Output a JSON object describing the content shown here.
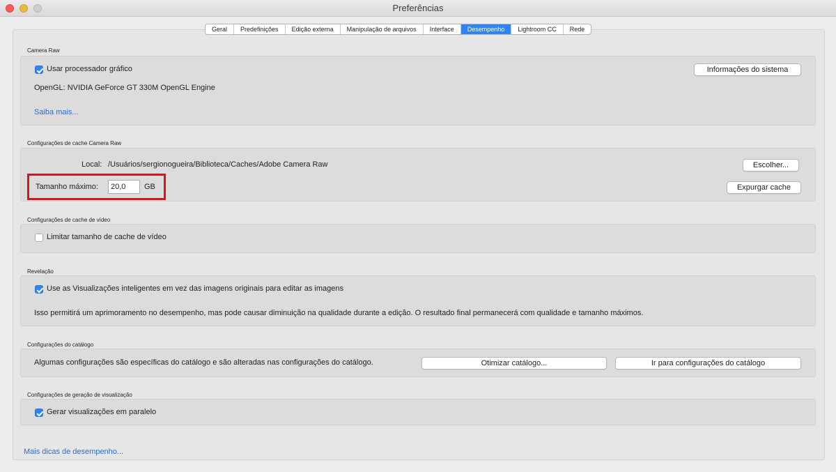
{
  "window": {
    "title": "Preferências"
  },
  "tabs": [
    {
      "label": "Geral",
      "active": false
    },
    {
      "label": "Predefinições",
      "active": false
    },
    {
      "label": "Edição externa",
      "active": false
    },
    {
      "label": "Manipulação de arquivos",
      "active": false
    },
    {
      "label": "Interface",
      "active": false
    },
    {
      "label": "Desempenho",
      "active": true
    },
    {
      "label": "Lightroom CC",
      "active": false
    },
    {
      "label": "Rede",
      "active": false
    }
  ],
  "camera_raw": {
    "section_label": "Camera Raw",
    "use_gpu_label": "Usar processador gráfico",
    "use_gpu_checked": true,
    "system_info_button": "Informações do sistema",
    "opengl_text": "OpenGL: NVIDIA GeForce GT 330M OpenGL Engine",
    "learn_more_link": "Saiba mais..."
  },
  "cache": {
    "section_label": "Configurações de cache Camera Raw",
    "location_label": "Local:",
    "location_path": "/Usuários/sergionogueira/Biblioteca/Caches/Adobe Camera Raw",
    "choose_button": "Escolher...",
    "max_size_label": "Tamanho máximo:",
    "max_size_value": "20,0",
    "max_size_unit": "GB",
    "purge_button": "Expurgar cache"
  },
  "video_cache": {
    "section_label": "Configurações de cache de vídeo",
    "limit_label": "Limitar tamanho de cache de vídeo",
    "limit_checked": false
  },
  "develop": {
    "section_label": "Revelação",
    "smart_previews_label": "Use as Visualizações inteligentes em vez das imagens originais para editar as imagens",
    "smart_previews_checked": true,
    "note": "Isso permitirá um aprimoramento no desempenho, mas pode causar diminuição na qualidade durante a edição. O resultado final permanecerá com qualidade e tamanho máximos."
  },
  "catalog": {
    "section_label": "Configurações do catálogo",
    "description": "Algumas configurações são específicas do catálogo e são alteradas nas configurações do catálogo.",
    "optimize_button": "Otimizar catálogo...",
    "goto_settings_button": "Ir para configurações do catálogo"
  },
  "preview_generation": {
    "section_label": "Configurações de geração de visualização",
    "parallel_label": "Gerar visualizações em paralelo",
    "parallel_checked": true
  },
  "footer": {
    "more_tips_link": "Mais dicas de desempenho..."
  },
  "colors": {
    "accent": "#2f83f3",
    "highlight_border": "#d8151c",
    "link": "#2f6bd6"
  }
}
